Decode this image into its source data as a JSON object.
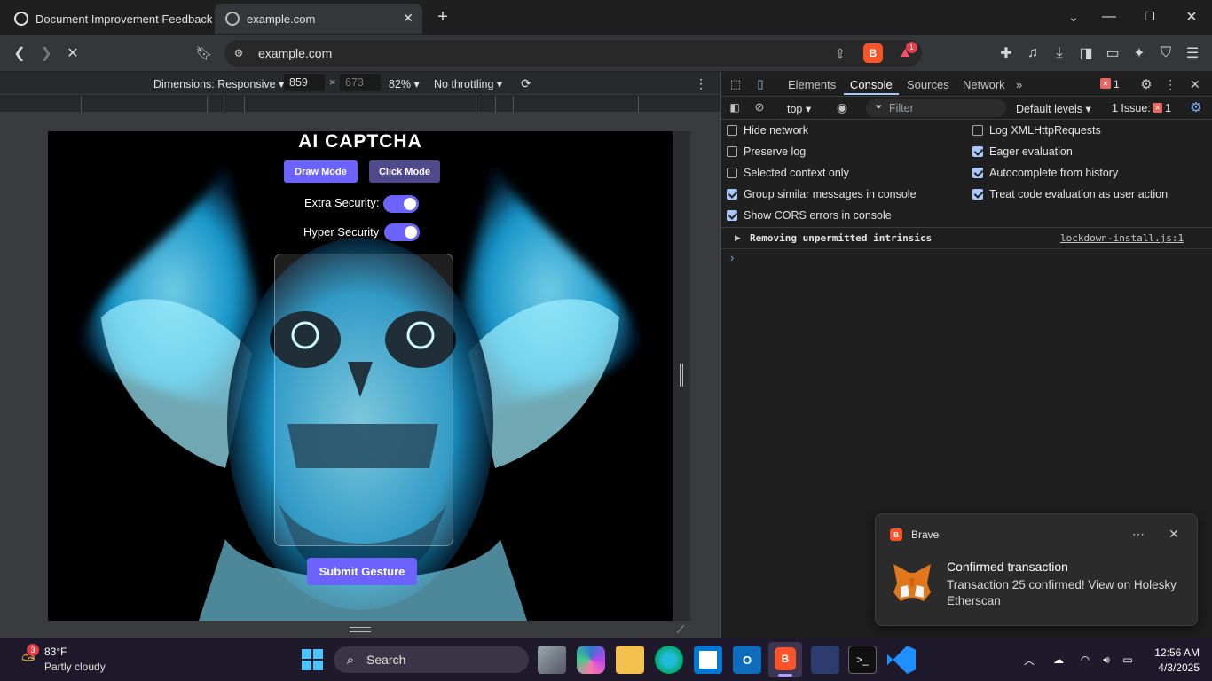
{
  "tabs": [
    {
      "label": "Document Improvement Feedback",
      "active": false
    },
    {
      "label": "example.com",
      "active": true
    }
  ],
  "address": {
    "url": "example.com"
  },
  "brave_badge": "1",
  "device_toolbar": {
    "dimensions": "Dimensions: Responsive",
    "width": "859",
    "height": "673",
    "zoom": "82%",
    "throttling": "No throttling"
  },
  "captcha": {
    "title": "AI CAPTCHA",
    "draw_mode": "Draw Mode",
    "click_mode": "Click Mode",
    "extra_security": "Extra Security:",
    "hyper_security": "Hyper Security",
    "submit": "Submit Gesture",
    "colors": {
      "accent": "#6c63ff",
      "click_btn": "#4f4a8c"
    }
  },
  "devtools": {
    "tabs": [
      "Elements",
      "Console",
      "Sources",
      "Network"
    ],
    "active_tab": "Console",
    "error_count": "1",
    "context": "top",
    "filter_placeholder": "Filter",
    "levels": "Default levels",
    "issues": "1 Issue:",
    "issues_count": "1",
    "settings_left": [
      {
        "label": "Hide network",
        "checked": false
      },
      {
        "label": "Preserve log",
        "checked": false
      },
      {
        "label": "Selected context only",
        "checked": false
      },
      {
        "label": "Group similar messages in console",
        "checked": true
      },
      {
        "label": "Show CORS errors in console",
        "checked": true
      }
    ],
    "settings_right": [
      {
        "label": "Log XMLHttpRequests",
        "checked": false
      },
      {
        "label": "Eager evaluation",
        "checked": true
      },
      {
        "label": "Autocomplete from history",
        "checked": true
      },
      {
        "label": "Treat code evaluation as user action",
        "checked": true
      }
    ],
    "console_message": "Removing unpermitted intrinsics",
    "console_source": "lockdown-install.js:1"
  },
  "notification": {
    "app": "Brave",
    "title": "Confirmed transaction",
    "body": "Transaction 25 confirmed! View on Holesky Etherscan"
  },
  "taskbar": {
    "weather_temp": "83°F",
    "weather_desc": "Partly cloudy",
    "weather_badge": "3",
    "search": "Search",
    "time": "12:56 AM",
    "date": "4/3/2025"
  }
}
